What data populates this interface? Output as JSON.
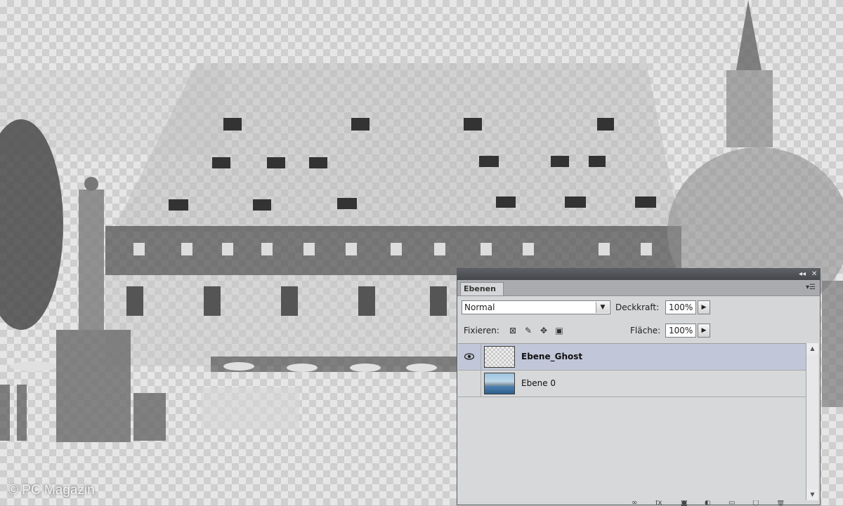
{
  "watermark": "© PC Magazin",
  "panel": {
    "tab_label": "Ebenen",
    "collapse_icon": "double-chevron-icon",
    "close_icon": "close-icon",
    "menu_icon": "panel-menu-icon",
    "blend_mode": "Normal",
    "opacity_label": "Deckkraft:",
    "opacity_value": "100%",
    "lock_label": "Fixieren:",
    "fill_label": "Fläche:",
    "fill_value": "100%",
    "layers": [
      {
        "name": "Ebene_Ghost",
        "visible": true,
        "selected": true,
        "thumbnail": "transparent"
      },
      {
        "name": "Ebene 0",
        "visible": false,
        "selected": false,
        "thumbnail": "photo"
      }
    ]
  }
}
